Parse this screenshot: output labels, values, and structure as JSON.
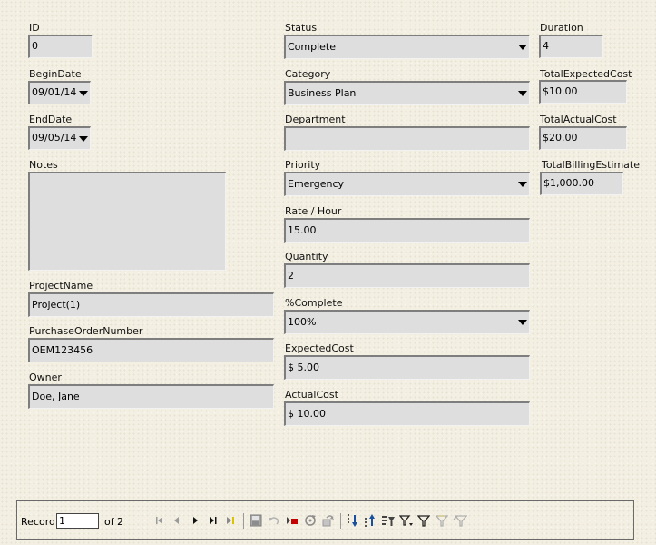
{
  "form": {
    "id": {
      "label": "ID",
      "value": "0"
    },
    "begin_date": {
      "label": "BeginDate",
      "value": "09/01/14"
    },
    "end_date": {
      "label": "EndDate",
      "value": "09/05/14"
    },
    "notes": {
      "label": "Notes",
      "value": ""
    },
    "project_name": {
      "label": "ProjectName",
      "value": "Project(1)"
    },
    "purchase_order_number": {
      "label": "PurchaseOrderNumber",
      "value": "OEM123456"
    },
    "owner": {
      "label": "Owner",
      "value": "Doe, Jane"
    },
    "status": {
      "label": "Status",
      "value": "Complete"
    },
    "category": {
      "label": "Category",
      "value": "Business Plan"
    },
    "department": {
      "label": "Department",
      "value": ""
    },
    "priority": {
      "label": "Priority",
      "value": "Emergency"
    },
    "rate_hour": {
      "label": "Rate / Hour",
      "value": "15.00"
    },
    "quantity": {
      "label": "Quantity",
      "value": "2"
    },
    "percent_complete": {
      "label": "%Complete",
      "value": "100%"
    },
    "expected_cost": {
      "label": "ExpectedCost",
      "value": "$ 5.00"
    },
    "actual_cost": {
      "label": "ActualCost",
      "value": "$ 10.00"
    },
    "duration": {
      "label": "Duration",
      "value": "4"
    },
    "total_expected_cost": {
      "label": "TotalExpectedCost",
      "value": "$10.00"
    },
    "total_actual_cost": {
      "label": "TotalActualCost",
      "value": "$20.00"
    },
    "total_billing_estimate": {
      "label": "TotalBillingEstimate",
      "value": "$1,000.00"
    }
  },
  "navigation": {
    "record_label": "Record",
    "record_value": "1",
    "of_label": "of",
    "total_records": "2",
    "icons": [
      "first-record-icon",
      "previous-record-icon",
      "next-record-icon",
      "last-record-icon",
      "new-record-icon",
      "save-record-icon",
      "undo-icon",
      "delete-record-icon",
      "refresh-icon",
      "refresh-control-icon",
      "sort-ascending-icon",
      "sort-descending-icon",
      "sort-icon",
      "autofilter-icon",
      "apply-filter-icon",
      "form-based-filter-icon",
      "reset-filter-icon"
    ]
  }
}
